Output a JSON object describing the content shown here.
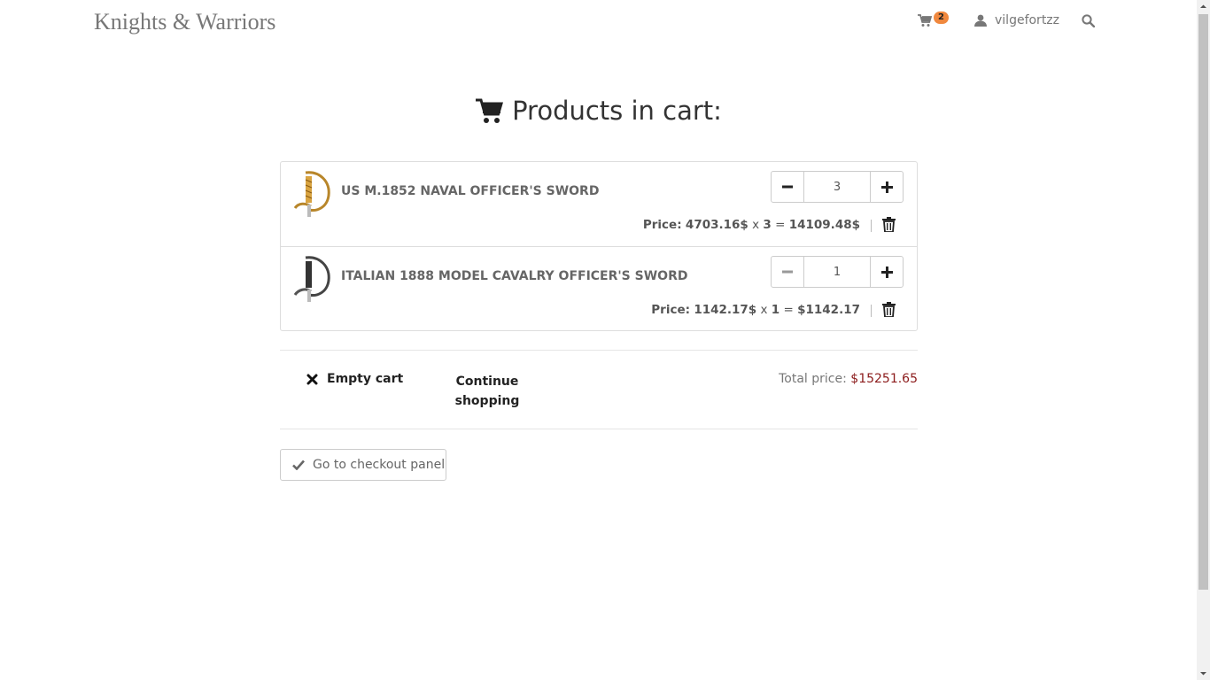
{
  "navbar": {
    "brand": "Knights & Warriors",
    "cart_count": "2",
    "username": "vilgefortzz"
  },
  "heading": {
    "title": "Products in cart:"
  },
  "cart": {
    "items": [
      {
        "name": "US M.1852 NAVAL OFFICER'S SWORD",
        "quantity": "3",
        "price_label": "Price:",
        "unit_price": "4703.16$",
        "times": "x",
        "qty_text": "3",
        "equals": "=",
        "subtotal": "14109.48$"
      },
      {
        "name": "ITALIAN 1888 MODEL CAVALRY OFFICER'S SWORD",
        "quantity": "1",
        "price_label": "Price:",
        "unit_price": "1142.17$",
        "times": "x",
        "qty_text": "1",
        "equals": "=",
        "subtotal": "$1142.17"
      }
    ]
  },
  "actions": {
    "empty_cart": "Empty cart",
    "continue_shopping": "Continue shopping",
    "total_label": "Total price:",
    "total_value": "$15251.65",
    "checkout": "Go to checkout panel"
  },
  "colors": {
    "badge": "#f0883e",
    "total_price": "#8b1a1a",
    "brand_text": "#777777"
  }
}
